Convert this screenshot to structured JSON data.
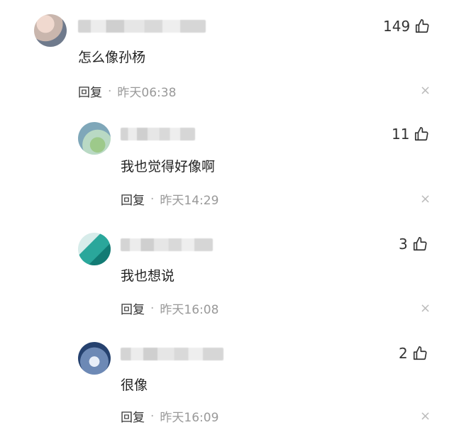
{
  "comments": [
    {
      "text": "怎么像孙杨",
      "likes": "149",
      "reply_label": "回复",
      "separator": "·",
      "time": "昨天06:38",
      "close_icon": "close-icon",
      "like_icon": "thumbs-up-icon"
    },
    {
      "text": "我也觉得好像啊",
      "likes": "11",
      "reply_label": "回复",
      "separator": "·",
      "time": "昨天14:29",
      "close_icon": "close-icon",
      "like_icon": "thumbs-up-icon"
    },
    {
      "text": "我也想说",
      "likes": "3",
      "reply_label": "回复",
      "separator": "·",
      "time": "昨天16:08",
      "close_icon": "close-icon",
      "like_icon": "thumbs-up-icon"
    },
    {
      "text": "很像",
      "likes": "2",
      "reply_label": "回复",
      "separator": "·",
      "time": "昨天16:09",
      "close_icon": "close-icon",
      "like_icon": "thumbs-up-icon"
    }
  ],
  "close_glyph": "×"
}
